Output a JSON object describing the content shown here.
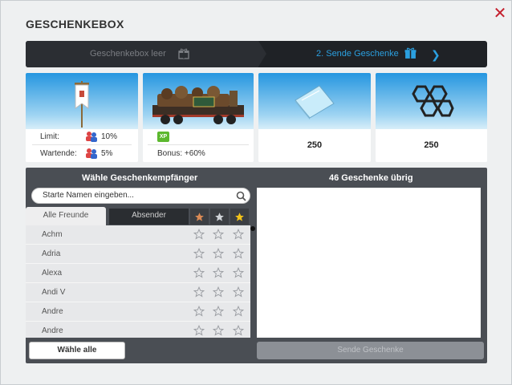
{
  "window": {
    "title": "GESCHENKEBOX",
    "close_icon": "close-icon"
  },
  "steps": [
    {
      "label": "Geschenkebox leer",
      "icon": "gift-icon",
      "active": false
    },
    {
      "label": "2. Sende Geschenke",
      "icon": "gift-icon",
      "active": true
    }
  ],
  "cards": {
    "banner": {
      "icon": "banner-icon",
      "limit_label": "Limit:",
      "limit_value": "10%",
      "waiting_label": "Wartende:",
      "waiting_value": "5%"
    },
    "train": {
      "icon": "freight-wagon-icon",
      "badge": "XP",
      "bonus": "Bonus: +60%"
    },
    "glass": {
      "icon": "glass-plate-icon",
      "amount": "250"
    },
    "honeycomb": {
      "icon": "hexagon-structure-icon",
      "amount": "250"
    }
  },
  "recipients": {
    "header": "Wähle Geschenkempfänger",
    "search_placeholder": "Starte Namen eingeben...",
    "tabs": [
      "Alle Freunde",
      "Absender"
    ],
    "star_filters": [
      "bronze-star",
      "silver-star",
      "gold-star"
    ],
    "rows": [
      "Achm",
      "Adria",
      "Alexa",
      "Andi V",
      "Andre",
      "Andre"
    ],
    "select_all": "Wähle alle"
  },
  "gifts": {
    "header": "46 Geschenke übrig",
    "send_button": "Sende Geschenke"
  },
  "colors": {
    "accent": "#2ba0e0",
    "close": "#c41f2d",
    "panel": "#4a4e54"
  }
}
